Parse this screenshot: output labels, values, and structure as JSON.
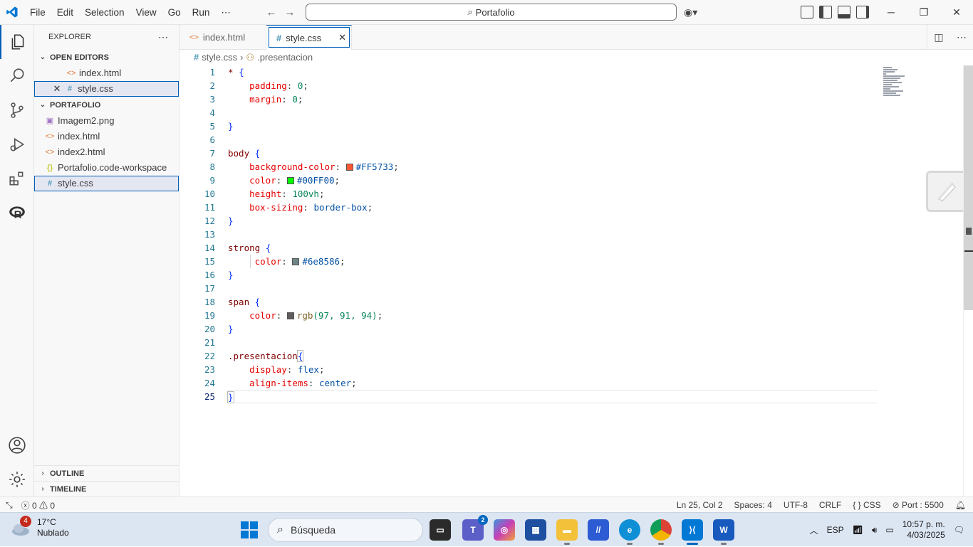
{
  "menu": [
    "File",
    "Edit",
    "Selection",
    "View",
    "Go",
    "Run",
    "⋯"
  ],
  "search": {
    "text": "Portafolio"
  },
  "explorer": {
    "title": "EXPLORER",
    "open_editors_label": "OPEN EDITORS",
    "open_editors": [
      {
        "name": "index.html",
        "type": "html"
      },
      {
        "name": "style.css",
        "type": "css"
      }
    ],
    "folder_label": "PORTAFOLIO",
    "files": [
      {
        "name": "Imagem2.png",
        "type": "img"
      },
      {
        "name": "index.html",
        "type": "html"
      },
      {
        "name": "index2.html",
        "type": "html"
      },
      {
        "name": "Portafolio.code-workspace",
        "type": "json"
      },
      {
        "name": "style.css",
        "type": "css"
      }
    ],
    "outline_label": "OUTLINE",
    "timeline_label": "TIMELINE"
  },
  "tabs": [
    {
      "label": "index.html",
      "icon": "<>"
    },
    {
      "label": "style.css",
      "icon": "#"
    }
  ],
  "breadcrumb": {
    "file": "style.css",
    "symbol": ".presentacion"
  },
  "code": {
    "line_numbers": [
      "1",
      "2",
      "3",
      "4",
      "5",
      "6",
      "7",
      "8",
      "9",
      "10",
      "11",
      "12",
      "13",
      "14",
      "15",
      "16",
      "17",
      "18",
      "19",
      "20",
      "21",
      "22",
      "23",
      "24",
      "25"
    ],
    "selectors": {
      "universal": "*",
      "body": "body",
      "strong": "strong",
      "span": "span",
      "presentacion": ".presentacion"
    },
    "props": {
      "padding": "padding",
      "margin": "margin",
      "background_color": "background-color",
      "color": "color",
      "height": "height",
      "box_sizing": "box-sizing",
      "display": "display",
      "align_items": "align-items"
    },
    "values": {
      "zero": "0",
      "bg_hex": "#FF5733",
      "color_hex": "#00FF00",
      "height_num": "100",
      "height_unit": "vh",
      "box_sizing": "border-box",
      "strong_hex": "#6e8586",
      "rgb_fn": "rgb",
      "rgb_args": "(97, 91, 94)",
      "display": "flex",
      "align": "center"
    },
    "swatches": {
      "bg": "#FF5733",
      "color": "#00FF00",
      "strong": "#6e8586",
      "span": "#615b5e"
    }
  },
  "status": {
    "errors": "0",
    "warnings": "0",
    "position": "Ln 25, Col 2",
    "spaces": "Spaces: 4",
    "encoding": "UTF-8",
    "eol": "CRLF",
    "language": "CSS",
    "port": "Port : 5500"
  },
  "taskbar": {
    "weather_temp": "17°C",
    "weather_desc": "Nublado",
    "weather_badge": "4",
    "search_placeholder": "Búsqueda",
    "teams_badge": "2",
    "lang": "ESP",
    "time": "10:57 p. m.",
    "date": "4/03/2025"
  },
  "colors": {
    "accent": "#005fb8",
    "css_icon": "#519aba",
    "html_icon": "#e37933"
  }
}
